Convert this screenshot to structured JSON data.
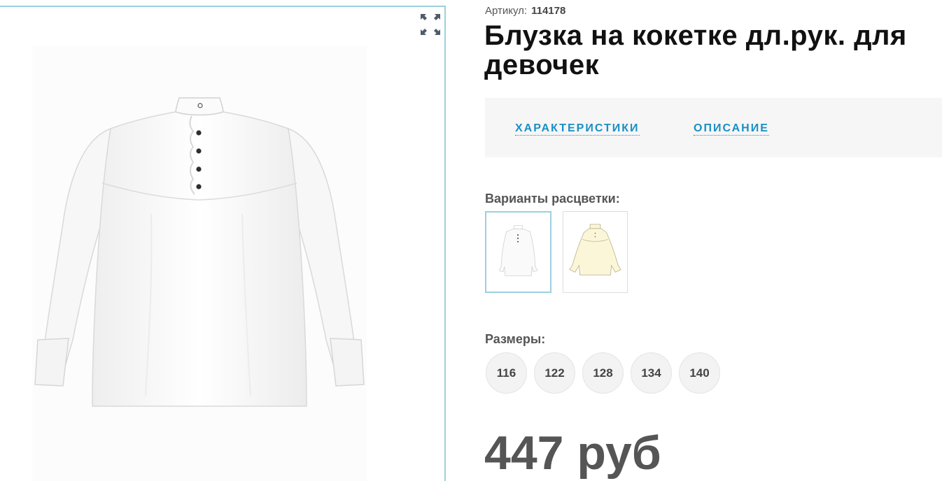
{
  "gallery": {
    "fullscreen_icon": "expand-icon",
    "photo_alt": "white long-sleeve blouse with ruffled placket"
  },
  "product": {
    "sku_label": "Артикул:",
    "sku_value": "114178",
    "title": "Блузка на кокетке дл.рук. для девочек"
  },
  "tabs": [
    {
      "label": "ХАРАКТЕРИСТИКИ"
    },
    {
      "label": "ОПИСАНИЕ"
    }
  ],
  "colors": {
    "label": "Варианты расцветки:",
    "options": [
      {
        "color": "#ffffff",
        "selected": true
      },
      {
        "color": "#fbf6d8",
        "selected": false
      }
    ]
  },
  "sizes": {
    "label": "Размеры:",
    "options": [
      {
        "label": "116"
      },
      {
        "label": "122"
      },
      {
        "label": "128"
      },
      {
        "label": "134"
      },
      {
        "label": "140"
      }
    ]
  },
  "price": {
    "text": "447 руб"
  },
  "theme": {
    "accent": "#1a8fc6",
    "frame": "#9bd0df"
  }
}
